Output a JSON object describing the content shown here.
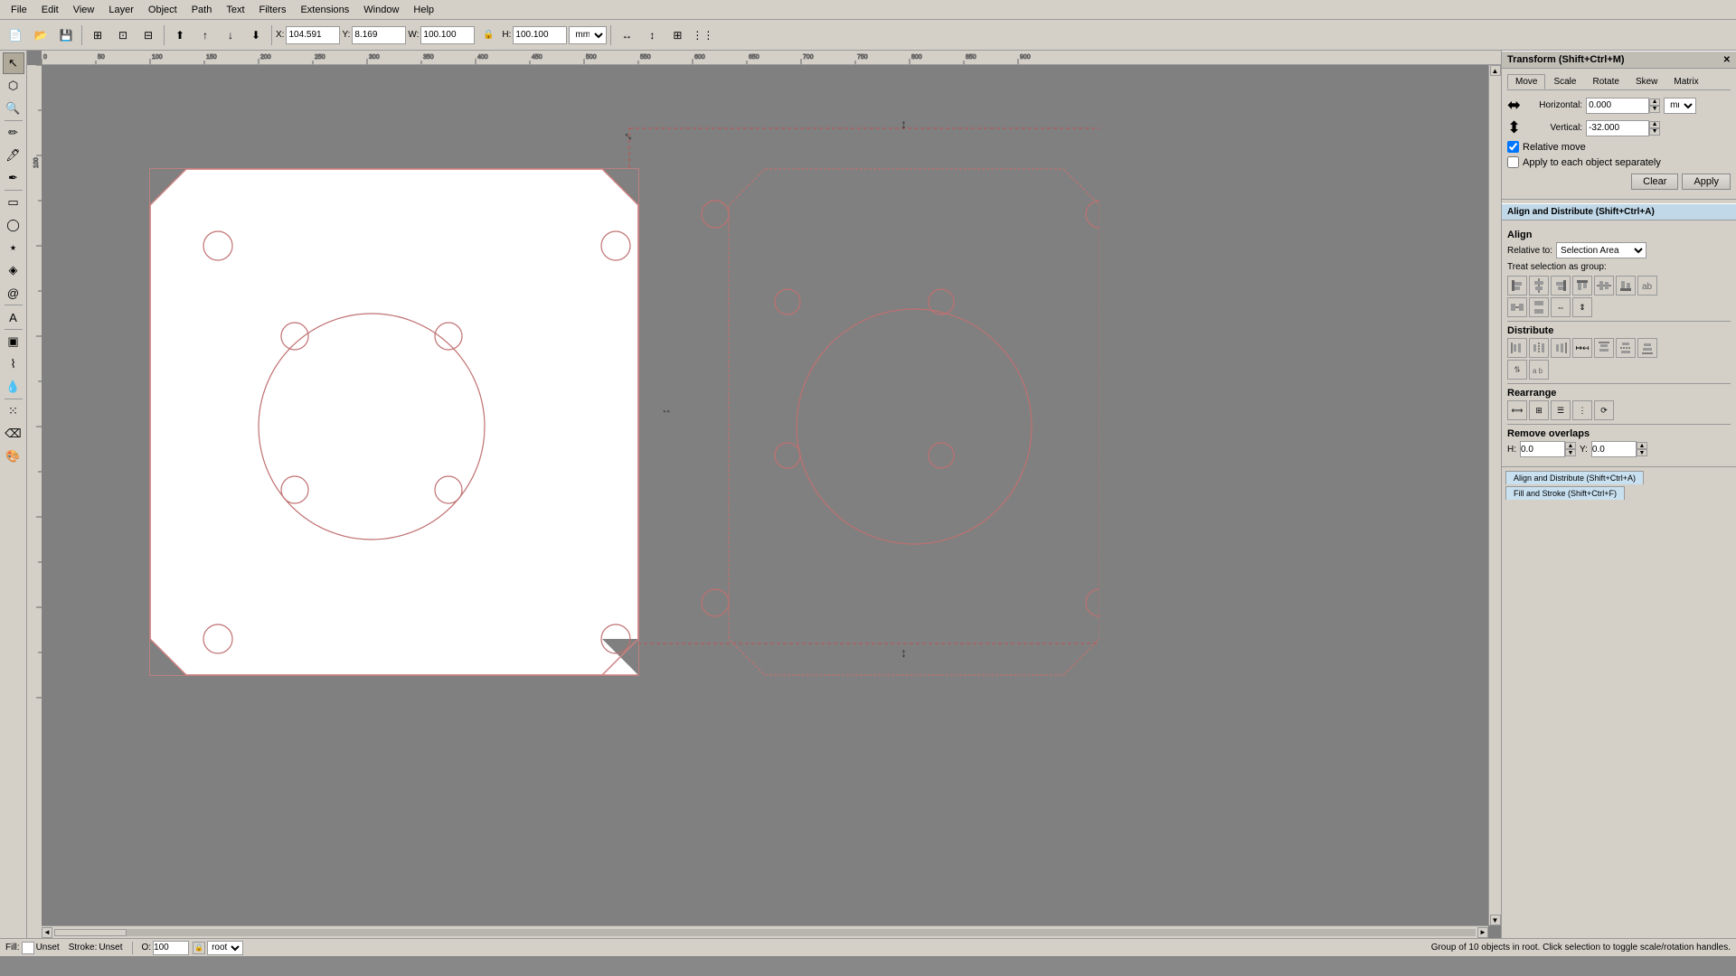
{
  "menubar": {
    "items": [
      "File",
      "Edit",
      "View",
      "Layer",
      "Object",
      "Path",
      "Text",
      "Filters",
      "Extensions",
      "Window",
      "Help"
    ]
  },
  "toolbar": {
    "x_label": "X:",
    "y_label": "Y:",
    "w_label": "W:",
    "h_label": "H:",
    "x_value": "104.591",
    "y_value": "8.169",
    "w_value": "100.100",
    "h_value": "100.100",
    "unit": "mm"
  },
  "transform_panel": {
    "title": "Transform (Shift+Ctrl+M)",
    "tabs": [
      "Move",
      "Scale",
      "Rotate",
      "Skew",
      "Matrix"
    ],
    "horizontal_label": "Horizontal:",
    "vertical_label": "Vertical:",
    "horizontal_value": "0.000",
    "vertical_value": "-32.000",
    "unit": "mm",
    "relative_move_label": "Relative move",
    "apply_each_label": "Apply to each object separately",
    "clear_label": "Clear",
    "apply_label": "Apply"
  },
  "align_panel": {
    "title": "Align and Distribute (Shift+Ctrl+A)",
    "align_label": "Align",
    "relative_to_label": "Relative to:",
    "relative_to_value": "Selection Area",
    "treat_as_group_label": "Treat selection as group:",
    "distribute_label": "Distribute",
    "rearrange_label": "Rearrange",
    "remove_overlaps_label": "Remove overlaps",
    "h_label": "H:",
    "v_label": "Y:",
    "h_value": "0.0",
    "v_value": "0.0"
  },
  "bottom_tabs": [
    {
      "label": "Align and Distribute (Shift+Ctrl+A)"
    },
    {
      "label": "Fill and Stroke (Shift+Ctrl+F)"
    }
  ],
  "statusbar": {
    "fill_label": "Fill:",
    "fill_value": "Unset",
    "stroke_label": "Stroke:",
    "stroke_value": "Unset",
    "opacity_label": "O:",
    "opacity_value": "100",
    "layer_value": "root",
    "status_text": "Group of 10 objects in root. Click selection to toggle scale/rotation handles."
  }
}
